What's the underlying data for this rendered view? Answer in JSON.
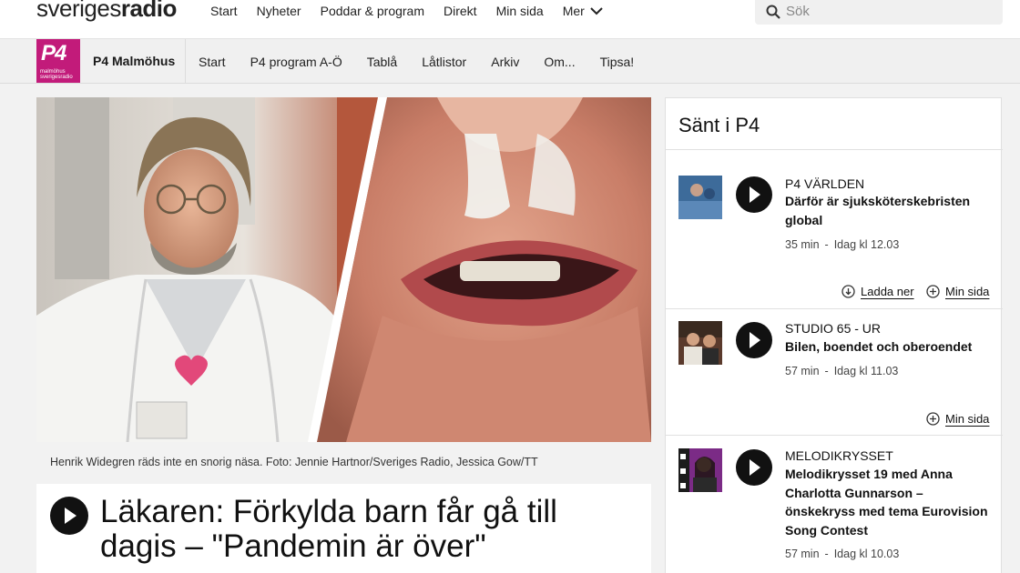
{
  "brand": {
    "logo_part1": "sveriges",
    "logo_part2": "radio"
  },
  "topnav": [
    "Start",
    "Nyheter",
    "Poddar & program",
    "Direkt",
    "Min sida"
  ],
  "topnav_more": "Mer",
  "search": {
    "placeholder": "Sök"
  },
  "channel": {
    "logo_big": "P4",
    "logo_small_1": "malmöhus",
    "logo_small_2": "sverigesradio",
    "name": "P4 Malmöhus",
    "nav": [
      "Start",
      "P4 program A-Ö",
      "Tablå",
      "Låtlistor",
      "Arkiv",
      "Om...",
      "Tipsa!"
    ]
  },
  "article": {
    "caption": "Henrik Widegren räds inte en snorig näsa. Foto: Jennie Hartnor/Sveriges Radio, Jessica Gow/TT",
    "headline": "Läkaren: Förkylda barn får gå till dagis – \"Pandemin är över\""
  },
  "sidebar": {
    "title": "Sänt i P4",
    "episodes": [
      {
        "program": "P4 VÄRLDEN",
        "title": "Därför är sjuksköterskebristen global",
        "duration": "35 min",
        "sep": "-",
        "time": "Idag kl 12.03",
        "download": "Ladda ner",
        "mypage": "Min sida"
      },
      {
        "program": "STUDIO 65 - UR",
        "title": "Bilen, boendet och oberoendet",
        "duration": "57 min",
        "sep": "-",
        "time": "Idag kl 11.03",
        "mypage": "Min sida"
      },
      {
        "program": "MELODIKRYSSET",
        "title": "Melodikrysset 19 med Anna Charlotta Gunnarson – önskekryss med tema Eurovision Song Contest",
        "duration": "57 min",
        "sep": "-",
        "time": "Idag kl 10.03"
      }
    ]
  },
  "colors": {
    "p4_magenta": "#c21b7a"
  }
}
